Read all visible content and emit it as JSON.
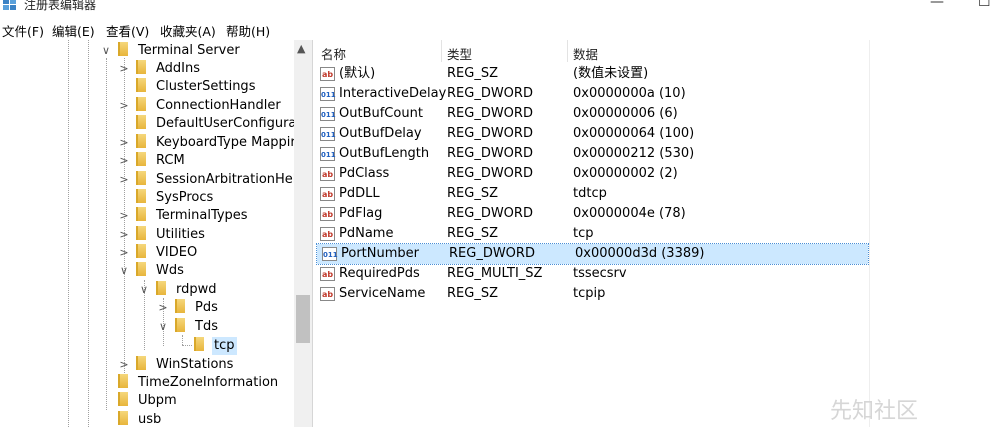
{
  "window": {
    "title": "注册表编辑器",
    "minimize_glyph": "—",
    "maximize_glyph": "☐"
  },
  "menu": [
    "文件(F)",
    "编辑(E)",
    "查看(V)",
    "收藏夹(A)",
    "帮助(H)"
  ],
  "tree": [
    {
      "label": "Terminal Server",
      "expander": "∨",
      "level": 0
    },
    {
      "label": "AddIns",
      "expander": ">",
      "level": 1
    },
    {
      "label": "ClusterSettings",
      "expander": "",
      "level": 1
    },
    {
      "label": "ConnectionHandler",
      "expander": ">",
      "level": 1
    },
    {
      "label": "DefaultUserConfigurati",
      "expander": "",
      "level": 1
    },
    {
      "label": "KeyboardType Mappir",
      "expander": ">",
      "level": 1
    },
    {
      "label": "RCM",
      "expander": ">",
      "level": 1
    },
    {
      "label": "SessionArbitrationHelp",
      "expander": ">",
      "level": 1
    },
    {
      "label": "SysProcs",
      "expander": "",
      "level": 1
    },
    {
      "label": "TerminalTypes",
      "expander": ">",
      "level": 1
    },
    {
      "label": "Utilities",
      "expander": ">",
      "level": 1
    },
    {
      "label": "VIDEO",
      "expander": ">",
      "level": 1
    },
    {
      "label": "Wds",
      "expander": "∨",
      "level": 1
    },
    {
      "label": "rdpwd",
      "expander": "∨",
      "level": 2
    },
    {
      "label": "Pds",
      "expander": ">",
      "level": 3
    },
    {
      "label": "Tds",
      "expander": "∨",
      "level": 3
    },
    {
      "label": "tcp",
      "expander": "",
      "level": 4,
      "selected": true
    },
    {
      "label": "WinStations",
      "expander": ">",
      "level": 1
    },
    {
      "label": "TimeZoneInformation",
      "expander": "",
      "level": 0
    },
    {
      "label": "Ubpm",
      "expander": "",
      "level": 0
    },
    {
      "label": "usb",
      "expander": "",
      "level": 0
    }
  ],
  "list": {
    "headers": {
      "name": "名称",
      "type": "类型",
      "data": "数据"
    },
    "rows": [
      {
        "icon": "ab",
        "name": "(默认)",
        "type": "REG_SZ",
        "data": "(数值未设置)"
      },
      {
        "icon": "011",
        "name": "InteractiveDelay",
        "type": "REG_DWORD",
        "data": "0x0000000a (10)"
      },
      {
        "icon": "011",
        "name": "OutBufCount",
        "type": "REG_DWORD",
        "data": "0x00000006 (6)"
      },
      {
        "icon": "011",
        "name": "OutBufDelay",
        "type": "REG_DWORD",
        "data": "0x00000064 (100)"
      },
      {
        "icon": "011",
        "name": "OutBufLength",
        "type": "REG_DWORD",
        "data": "0x00000212 (530)"
      },
      {
        "icon": "ab",
        "name": "PdClass",
        "type": "REG_DWORD",
        "data": "0x00000002 (2)"
      },
      {
        "icon": "ab",
        "name": "PdDLL",
        "type": "REG_SZ",
        "data": "tdtcp"
      },
      {
        "icon": "ab",
        "name": "PdFlag",
        "type": "REG_DWORD",
        "data": "0x0000004e (78)"
      },
      {
        "icon": "ab",
        "name": "PdName",
        "type": "REG_SZ",
        "data": "tcp"
      },
      {
        "icon": "011",
        "name": "PortNumber",
        "type": "REG_DWORD",
        "data": "0x00000d3d (3389)",
        "selected": true
      },
      {
        "icon": "ab",
        "name": "RequiredPds",
        "type": "REG_MULTI_SZ",
        "data": "tssecsrv"
      },
      {
        "icon": "ab",
        "name": "ServiceName",
        "type": "REG_SZ",
        "data": "tcpip"
      }
    ]
  },
  "watermark": "先知社区"
}
